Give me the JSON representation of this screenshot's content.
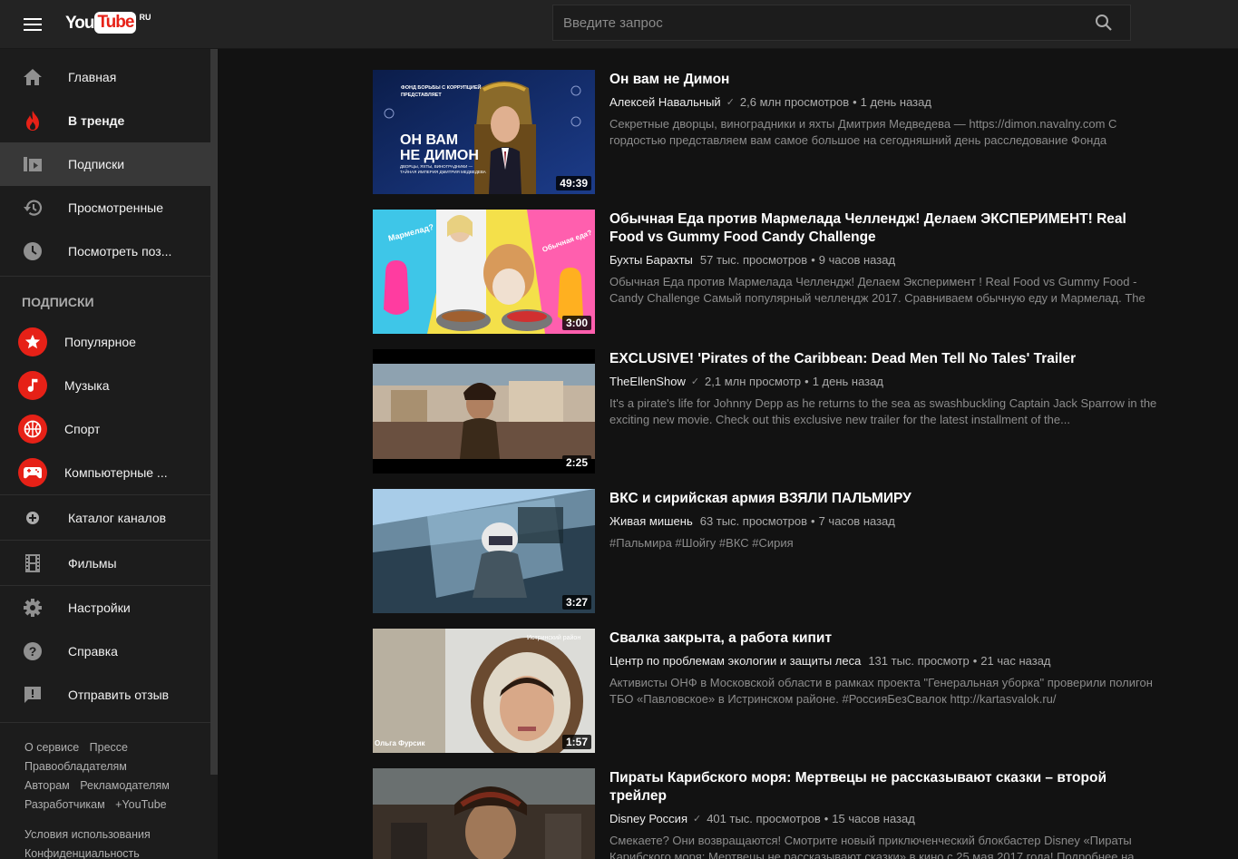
{
  "header": {
    "logo_you": "You",
    "logo_tube": "Tube",
    "logo_country": "RU",
    "search_placeholder": "Введите запрос"
  },
  "sidebar": {
    "main": [
      {
        "label": "Главная",
        "icon": "home-icon"
      },
      {
        "label": "В тренде",
        "icon": "flame-icon"
      },
      {
        "label": "Подписки",
        "icon": "subscriptions-icon"
      },
      {
        "label": "Просмотренные",
        "icon": "history-icon"
      },
      {
        "label": "Посмотреть поз...",
        "icon": "clock-icon"
      }
    ],
    "subscriptions_title": "ПОДПИСКИ",
    "subscriptions": [
      {
        "label": "Популярное",
        "icon": "star-icon"
      },
      {
        "label": "Музыка",
        "icon": "music-note-icon"
      },
      {
        "label": "Спорт",
        "icon": "basketball-icon"
      },
      {
        "label": "Компьютерные ...",
        "icon": "gamepad-icon"
      }
    ],
    "catalog": "Каталог каналов",
    "films": "Фильмы",
    "settings": "Настройки",
    "help": "Справка",
    "feedback": "Отправить отзыв",
    "footer1": [
      "О сервисе",
      "Прессе",
      "Правообладателям",
      "Авторам",
      "Рекламодателям",
      "Разработчикам",
      "+YouTube"
    ],
    "footer2": [
      "Условия использования",
      "Конфиденциальность"
    ]
  },
  "videos": [
    {
      "title": "Он вам не Димон",
      "channel": "Алексей Навальный",
      "verified": true,
      "views": "2,6 млн просмотров",
      "age": "1 день назад",
      "description": "Секретные дворцы, виноградники и яхты Дмитрия Медведева — https://dimon.navalny.com С гордостью представляем вам самое большое на сегодняшний день расследование Фонда",
      "duration": "49:39",
      "thumb_text": [
        "ФОНД БОРЬБЫ С КОРРУПЦИЕЙ",
        "ПРЕДСТАВЛЯЕТ",
        "ОН ВАМ",
        "НЕ ДИМОН",
        "ДВОРЦЫ, ЯХТЫ, ВИНОГРАДНИКИ —",
        "ТАЙНАЯ ИМПЕРИЯ ДМИТРИЯ МЕДВЕДЕВА"
      ]
    },
    {
      "title": "Обычная Еда против Мармелада Челлендж! Делаем ЭКСПЕРИМЕНТ! Real Food vs Gummy Food Candy Challenge",
      "channel": "Бухты Барахты",
      "verified": false,
      "views": "57 тыс. просмотров",
      "age": "9 часов назад",
      "description": "Обычная Еда против Мармелада Челлендж! Делаем Эксперимент ! Real Food vs Gummy Food - Candy Challenge Самый популярный челлендж 2017. Сравниваем обычную еду и Мармелад. The",
      "duration": "3:00",
      "thumb_text": [
        "Мармелад?",
        "Обычная еда?"
      ]
    },
    {
      "title": "EXCLUSIVE! 'Pirates of the Caribbean: Dead Men Tell No Tales' Trailer",
      "channel": "TheEllenShow",
      "verified": true,
      "views": "2,1 млн просмотр",
      "age": "1 день назад",
      "description": "It's a pirate's life for Johnny Depp as he returns to the sea as swashbuckling Captain Jack Sparrow in the exciting new movie. Check out this exclusive new trailer for the latest installment of the...",
      "duration": "2:25"
    },
    {
      "title": "ВКС и сирийская армия ВЗЯЛИ ПАЛЬМИРУ",
      "channel": "Живая мишень",
      "verified": false,
      "views": "63 тыс. просмотров",
      "age": "7 часов назад",
      "description": "#Пальмира #Шойгу #ВКС #Сирия",
      "duration": "3:27"
    },
    {
      "title": "Свалка закрыта, а работа кипит",
      "channel": "Центр по проблемам экологии и защиты леса",
      "verified": false,
      "views": "131 тыс. просмотр",
      "age": "21 час назад",
      "description": "Активисты ОНФ в Московской области в рамках проекта \"Генеральная уборка\" проверили полигон ТБО «Павловское» в Истринском районе. #РоссияБезСвалок http://kartasvalok.ru/",
      "duration": "1:57",
      "thumb_text": [
        "Истринский район",
        "Ольга Фурсик"
      ]
    },
    {
      "title": "Пираты Карибского моря: Мертвецы не рассказывают сказки – второй трейлер",
      "channel": "Disney Россия",
      "verified": true,
      "views": "401 тыс. просмотров",
      "age": "15 часов назад",
      "description": "Смекаете? Они возвращаются! Смотрите новый приключенческий блокбастер Disney «Пираты Карибского моря: Мертвецы не рассказывают сказки» в кино с 25 мая 2017 года! Подробнее на",
      "duration": ""
    }
  ],
  "colors": {
    "brand_red": "#e62117",
    "background": "#121212",
    "sidebar": "#1c1c1c",
    "header": "#232323"
  }
}
